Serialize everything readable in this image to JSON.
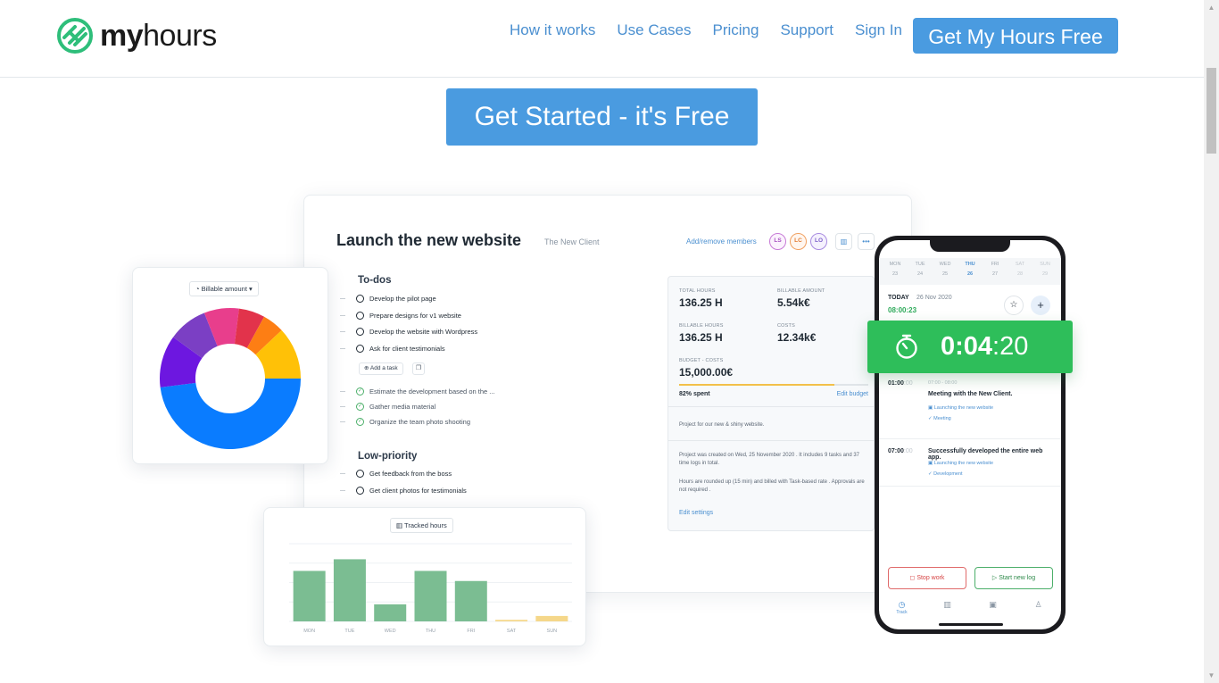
{
  "brand": {
    "name_bold": "my",
    "name_light": "hours",
    "color": "#2ebe7a"
  },
  "nav": {
    "items": [
      "How it works",
      "Use Cases",
      "Pricing",
      "Support",
      "Sign In"
    ],
    "cta": "Get My Hours Free"
  },
  "hero": {
    "cta": "Get Started - it's Free"
  },
  "project": {
    "title": "Launch the new website",
    "client": "The New Client",
    "add_members": "Add/remove members",
    "members": [
      "LS",
      "LC",
      "LO"
    ],
    "todos_title": "To-dos",
    "todos": [
      "Develop the pilot page",
      "Prepare designs for v1 website",
      "Develop the website with Wordpress",
      "Ask for client testimonials"
    ],
    "add_task": "Add a task",
    "done": [
      "Estimate the development based on the ...",
      "Gather media material",
      "Organize the team photo shooting"
    ],
    "lowprio_title": "Low-priority",
    "lowprio": [
      "Get feedback from the boss",
      "Get client photos for testimonials"
    ]
  },
  "stats": {
    "total_hours_label": "TOTAL HOURS",
    "total_hours": "136.25 H",
    "billable_amount_label": "BILLABLE AMOUNT",
    "billable_amount": "5.54k€",
    "billable_hours_label": "BILLABLE HOURS",
    "billable_hours": "136.25 H",
    "costs_label": "COSTS",
    "costs": "12.34k€",
    "budget_label": "BUDGET - COSTS",
    "budget": "15,000.00€",
    "spent": "82% spent",
    "spent_fraction": 0.82,
    "edit_budget": "Edit budget",
    "description": "Project for our new & shiny website.",
    "created": "Project was created on Wed, 25 November 2020 . It includes 9 tasks and 37 time logs in total.",
    "rounding": "Hours are rounded up (15 min) and billed with Task-based rate . Approvals are not required .",
    "edit_settings": "Edit settings"
  },
  "donut": {
    "selector": "Billable amount",
    "slices": [
      {
        "value": 48,
        "color": "#0a7cff"
      },
      {
        "value": 12,
        "color": "#6d17e0"
      },
      {
        "value": 9,
        "color": "#7b3fc4"
      },
      {
        "value": 8,
        "color": "#e83e8c"
      },
      {
        "value": 6,
        "color": "#e2334b"
      },
      {
        "value": 5,
        "color": "#fd7e14"
      },
      {
        "value": 12,
        "color": "#ffc107"
      }
    ]
  },
  "chart_data": {
    "type": "bar",
    "title": "Tracked hours",
    "categories": [
      "MON",
      "TUE",
      "WED",
      "THU",
      "FRI",
      "SAT",
      "SUN"
    ],
    "values": [
      6.5,
      8,
      2.2,
      6.5,
      5.2,
      0.2,
      0.7
    ],
    "colors": [
      "#7bbd92",
      "#7bbd92",
      "#7bbd92",
      "#7bbd92",
      "#7bbd92",
      "#f5d78a",
      "#f5d78a"
    ],
    "ylim": [
      0,
      10
    ]
  },
  "phone": {
    "week": [
      {
        "d": "MON",
        "n": "23"
      },
      {
        "d": "TUE",
        "n": "24"
      },
      {
        "d": "WED",
        "n": "25"
      },
      {
        "d": "THU",
        "n": "26"
      },
      {
        "d": "FRI",
        "n": "27"
      },
      {
        "d": "SAT",
        "n": "28"
      },
      {
        "d": "SUN",
        "n": "29"
      }
    ],
    "today_label": "TODAY",
    "today_date": "26 Nov 2020",
    "today_total": "08:00:23",
    "timer_main": "0:04",
    "timer_sec": ":20",
    "logs": [
      {
        "time": "01:00",
        "time_sec": ":00",
        "range": "07:00 - 08:00",
        "desc": "Meeting with the New Client.",
        "project": "Launching the new website",
        "tag": "Meeting"
      },
      {
        "time": "07:00",
        "time_sec": ":00",
        "range": "",
        "desc": "Successfully developed the entire web app.",
        "project": "Launching the new website",
        "tag": "Development"
      }
    ],
    "stop": "Stop work",
    "start": "Start new log",
    "tab_track": "Track"
  }
}
